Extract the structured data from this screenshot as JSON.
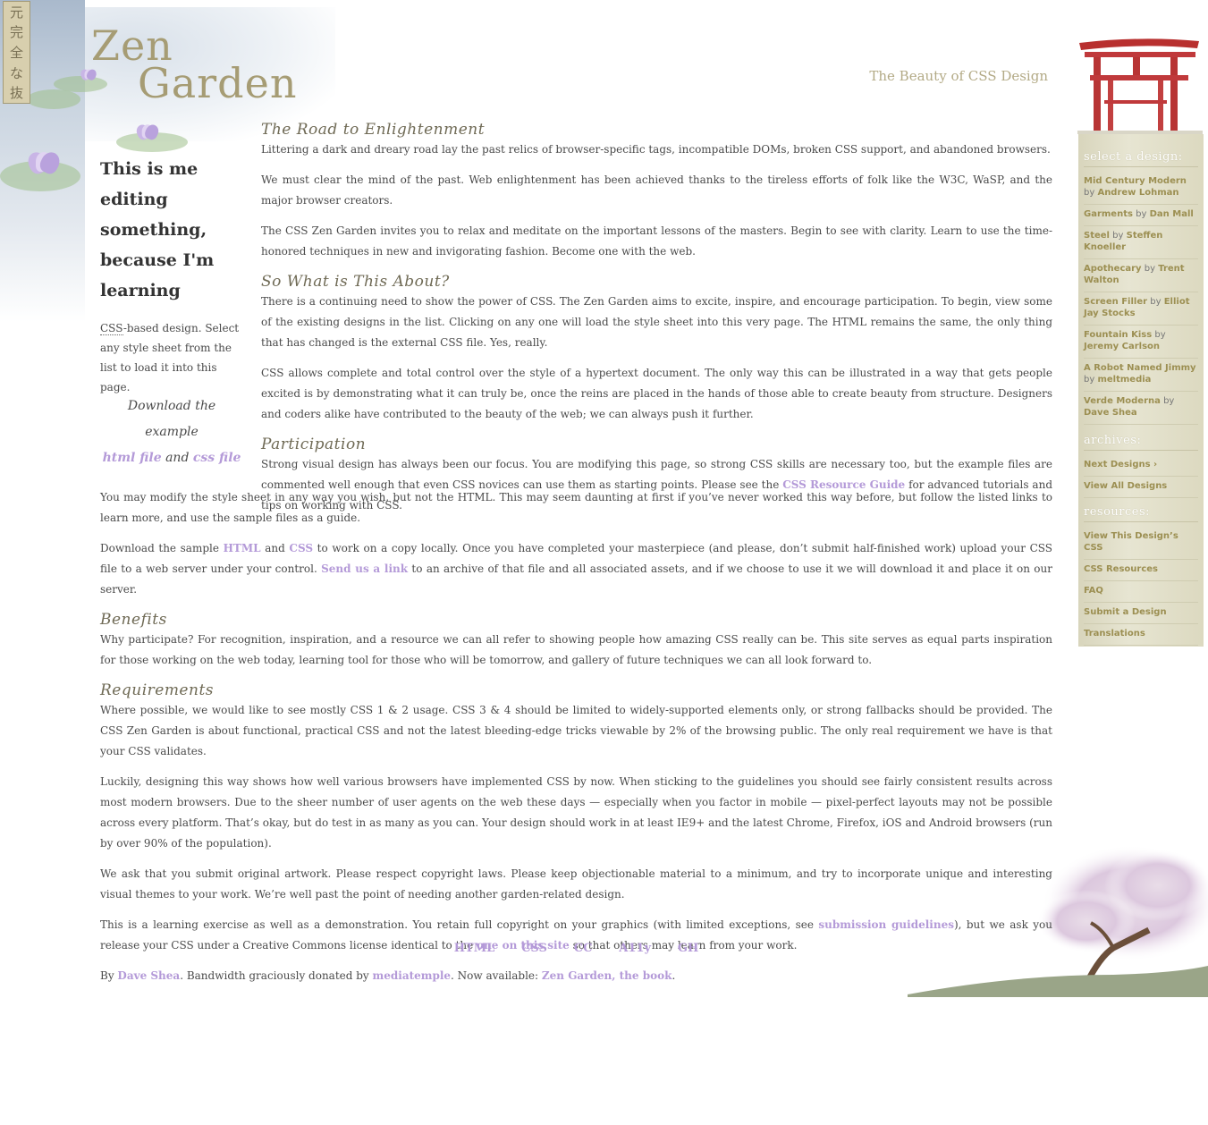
{
  "kanji": [
    "元",
    "完",
    "全",
    "な",
    "抜"
  ],
  "header": {
    "title_line1": "Zen",
    "title_line2": "Garden",
    "tagline": "The Beauty of CSS Design"
  },
  "intro": {
    "heading": "This is me editing something, because I'm learning",
    "text_abbr": "CSS",
    "text_rest": "-based design. Select any style sheet from the list to load it into this page.",
    "download_prefix": "Download the example",
    "html_link": "html file",
    "and": "and",
    "css_link": "css file"
  },
  "sections": {
    "enlightenment": {
      "title": "The Road to Enlightenment",
      "p1": "Littering a dark and dreary road lay the past relics of browser-specific tags, incompatible DOMs, broken CSS support, and abandoned browsers.",
      "p2": "We must clear the mind of the past. Web enlightenment has been achieved thanks to the tireless efforts of folk like the W3C, WaSP, and the major browser creators.",
      "p3": "The CSS Zen Garden invites you to relax and meditate on the important lessons of the masters. Begin to see with clarity. Learn to use the time-honored techniques in new and invigorating fashion. Become one with the web."
    },
    "about": {
      "title": "So What is This About?",
      "p1": "There is a continuing need to show the power of CSS. The Zen Garden aims to excite, inspire, and encourage participation. To begin, view some of the existing designs in the list. Clicking on any one will load the style sheet into this very page. The HTML remains the same, the only thing that has changed is the external CSS file. Yes, really.",
      "p2": "CSS allows complete and total control over the style of a hypertext document. The only way this can be illustrated in a way that gets people excited is by demonstrating what it can truly be, once the reins are placed in the hands of those able to create beauty from structure. Designers and coders alike have contributed to the beauty of the web; we can always push it further."
    },
    "participation": {
      "title": "Participation",
      "p1_before": "Strong visual design has always been our focus. You are modifying this page, so strong CSS skills are necessary too, but the example files are commented well enough that even CSS novices can use them as starting points. Please see the ",
      "p1_link": "CSS Resource Guide",
      "p1_after": " for advanced tutorials and tips on working with CSS.",
      "p2": "You may modify the style sheet in any way you wish, but not the HTML. This may seem daunting at first if you’ve never worked this way before, but follow the listed links to learn more, and use the sample files as a guide.",
      "p3_a": "Download the sample ",
      "p3_html": "HTML",
      "p3_and": " and ",
      "p3_css": "CSS",
      "p3_b": " to work on a copy locally. Once you have completed your masterpiece (and please, don’t submit half-finished work) upload your CSS file to a web server under your control. ",
      "p3_send": "Send us a link",
      "p3_c": " to an archive of that file and all associated assets, and if we choose to use it we will download it and place it on our server."
    },
    "benefits": {
      "title": "Benefits",
      "p1": "Why participate? For recognition, inspiration, and a resource we can all refer to showing people how amazing CSS really can be. This site serves as equal parts inspiration for those working on the web today, learning tool for those who will be tomorrow, and gallery of future techniques we can all look forward to."
    },
    "requirements": {
      "title": "Requirements",
      "p1": "Where possible, we would like to see mostly CSS 1 & 2 usage. CSS 3 & 4 should be limited to widely-supported elements only, or strong fallbacks should be provided. The CSS Zen Garden is about functional, practical CSS and not the latest bleeding-edge tricks viewable by 2% of the browsing public. The only real requirement we have is that your CSS validates.",
      "p2": "Luckily, designing this way shows how well various browsers have implemented CSS by now. When sticking to the guidelines you should see fairly consistent results across most modern browsers. Due to the sheer number of user agents on the web these days — especially when you factor in mobile — pixel-perfect layouts may not be possible across every platform. That’s okay, but do test in as many as you can. Your design should work in at least IE9+ and the latest Chrome, Firefox, iOS and Android browsers (run by over 90% of the population).",
      "p3": "We ask that you submit original artwork. Please respect copyright laws. Please keep objectionable material to a minimum, and try to incorporate unique and interesting visual themes to your work. We’re well past the point of needing another garden-related design.",
      "p4_a": "This is a learning exercise as well as a demonstration. You retain full copyright on your graphics (with limited exceptions, see ",
      "p4_link1": "submission guidelines",
      "p4_b": "), but we ask you release your CSS under a Creative Commons license identical to the ",
      "p4_link2": "one on this site",
      "p4_c": " so that others may learn from your work.",
      "p5_a": "By ",
      "p5_link1": "Dave Shea",
      "p5_b": ". Bandwidth graciously donated by ",
      "p5_link2": "mediatemple",
      "p5_c": ". Now available: ",
      "p5_link3": "Zen Garden, the book",
      "p5_d": "."
    }
  },
  "footer": [
    "HTML",
    "CSS",
    "CC",
    "A11y",
    "GH"
  ],
  "sidebar": {
    "select_title": "select a design:",
    "designs": [
      {
        "name": "Mid Century Modern",
        "by": "by",
        "author": "Andrew Lohman"
      },
      {
        "name": "Garments",
        "by": "by",
        "author": "Dan Mall"
      },
      {
        "name": "Steel",
        "by": "by",
        "author": "Steffen Knoeller"
      },
      {
        "name": "Apothecary",
        "by": "by",
        "author": "Trent Walton"
      },
      {
        "name": "Screen Filler",
        "by": "by",
        "author": "Elliot Jay Stocks"
      },
      {
        "name": "Fountain Kiss",
        "by": "by",
        "author": "Jeremy Carlson"
      },
      {
        "name": "A Robot Named Jimmy",
        "by": "by",
        "author": "meltmedia"
      },
      {
        "name": "Verde Moderna",
        "by": "by",
        "author": "Dave Shea"
      }
    ],
    "archives_title": "archives:",
    "archives": [
      "Next Designs ›",
      "View All Designs"
    ],
    "resources_title": "resources:",
    "resources": [
      "View This Design’s CSS",
      "CSS Resources",
      "FAQ",
      "Submit a Design",
      "Translations"
    ]
  },
  "colors": {
    "link": "#b49ad8",
    "sidebar_link": "#9c8f52",
    "heading": "#6f6a55",
    "title": "#a69c74",
    "torii": "#c0393b"
  }
}
